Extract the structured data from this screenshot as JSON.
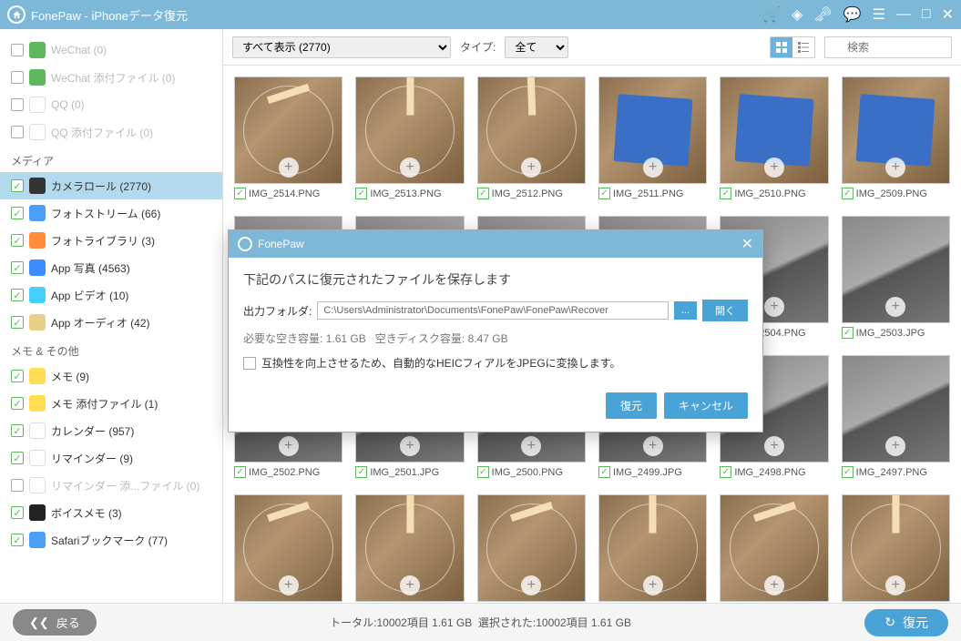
{
  "titlebar": {
    "title": "FonePaw - iPhoneデータ復元"
  },
  "sidebar": {
    "groups": [
      {
        "label": "",
        "items": [
          {
            "label": "WeChat (0)",
            "checked": false,
            "disabled": true,
            "icon": "icon-wechat"
          },
          {
            "label": "WeChat 添付ファイル (0)",
            "checked": false,
            "disabled": true,
            "icon": "icon-wechat"
          },
          {
            "label": "QQ (0)",
            "checked": false,
            "disabled": true,
            "icon": "icon-qq"
          },
          {
            "label": "QQ 添付ファイル (0)",
            "checked": false,
            "disabled": true,
            "icon": "icon-qq"
          }
        ]
      },
      {
        "label": "メディア",
        "items": [
          {
            "label": "カメラロール (2770)",
            "checked": true,
            "active": true,
            "icon": "icon-camera"
          },
          {
            "label": "フォトストリーム (66)",
            "checked": true,
            "icon": "icon-photostream"
          },
          {
            "label": "フォトライブラリ (3)",
            "checked": true,
            "icon": "icon-photolib"
          },
          {
            "label": "App 写真 (4563)",
            "checked": true,
            "icon": "icon-appphoto"
          },
          {
            "label": "App ビデオ (10)",
            "checked": true,
            "icon": "icon-appvideo"
          },
          {
            "label": "App オーディオ (42)",
            "checked": true,
            "icon": "icon-appaudio"
          }
        ]
      },
      {
        "label": "メモ & その他",
        "items": [
          {
            "label": "メモ (9)",
            "checked": true,
            "icon": "icon-memo"
          },
          {
            "label": "メモ 添付ファイル (1)",
            "checked": true,
            "icon": "icon-memo"
          },
          {
            "label": "カレンダー (957)",
            "checked": true,
            "icon": "icon-cal"
          },
          {
            "label": "リマインダー (9)",
            "checked": true,
            "icon": "icon-remind"
          },
          {
            "label": "リマインダー 添...ファイル (0)",
            "checked": false,
            "disabled": true,
            "icon": "icon-remind"
          },
          {
            "label": "ボイスメモ (3)",
            "checked": true,
            "icon": "icon-voice"
          },
          {
            "label": "Safariブックマーク (77)",
            "checked": true,
            "icon": "icon-safari"
          }
        ]
      }
    ]
  },
  "toolbar": {
    "display_select": "すべて表示 (2770)",
    "type_label": "タイプ:",
    "type_select": "全て",
    "search_placeholder": "検索"
  },
  "thumbs": [
    {
      "label": "IMG_2514.PNG",
      "variant": "wr1"
    },
    {
      "label": "IMG_2513.PNG",
      "variant": "wr2"
    },
    {
      "label": "IMG_2512.PNG",
      "variant": "wr3"
    },
    {
      "label": "IMG_2511.PNG",
      "variant": "blue"
    },
    {
      "label": "IMG_2510.PNG",
      "variant": "blue"
    },
    {
      "label": "IMG_2509.PNG",
      "variant": "blue"
    },
    {
      "label": "",
      "variant": "gray"
    },
    {
      "label": "",
      "variant": "gray"
    },
    {
      "label": "",
      "variant": "gray"
    },
    {
      "label": "",
      "variant": "gray"
    },
    {
      "label": "IMG_2504.PNG",
      "variant": "gray2"
    },
    {
      "label": "IMG_2503.JPG",
      "variant": "gray2"
    },
    {
      "label": "IMG_2502.PNG",
      "variant": "gray"
    },
    {
      "label": "IMG_2501.JPG",
      "variant": "gray"
    },
    {
      "label": "IMG_2500.PNG",
      "variant": "gray"
    },
    {
      "label": "IMG_2499.JPG",
      "variant": "gray"
    },
    {
      "label": "IMG_2498.PNG",
      "variant": "gray"
    },
    {
      "label": "IMG_2497.PNG",
      "variant": "gray"
    },
    {
      "label": "",
      "variant": "wr1"
    },
    {
      "label": "",
      "variant": "wr2"
    },
    {
      "label": "",
      "variant": "wr1"
    },
    {
      "label": "",
      "variant": "wr2"
    },
    {
      "label": "",
      "variant": "wr1"
    },
    {
      "label": "",
      "variant": "wr2"
    }
  ],
  "modal": {
    "title": "FonePaw",
    "desc": "下記のパスに復元されたファイルを保存します",
    "folder_label": "出力フォルダ:",
    "path": "C:\\Users\\Administrator\\Documents\\FonePaw\\FonePaw\\Recover",
    "browse": "...",
    "open": "開く",
    "required_label": "必要な空き容量:",
    "required_value": "1.61 GB",
    "free_label": "空きディスク容量:",
    "free_value": "8.47 GB",
    "heic": "互換性を向上させるため、自動的なHEICフィアルをJPEGに変換します。",
    "ok": "復元",
    "cancel": "キャンセル"
  },
  "bottom": {
    "back": "戻る",
    "total_label": "トータル:",
    "total_value": "10002項目 1.61 GB",
    "selected_label": "選択された:",
    "selected_value": "10002項目 1.61 GB",
    "recover": "復元"
  }
}
